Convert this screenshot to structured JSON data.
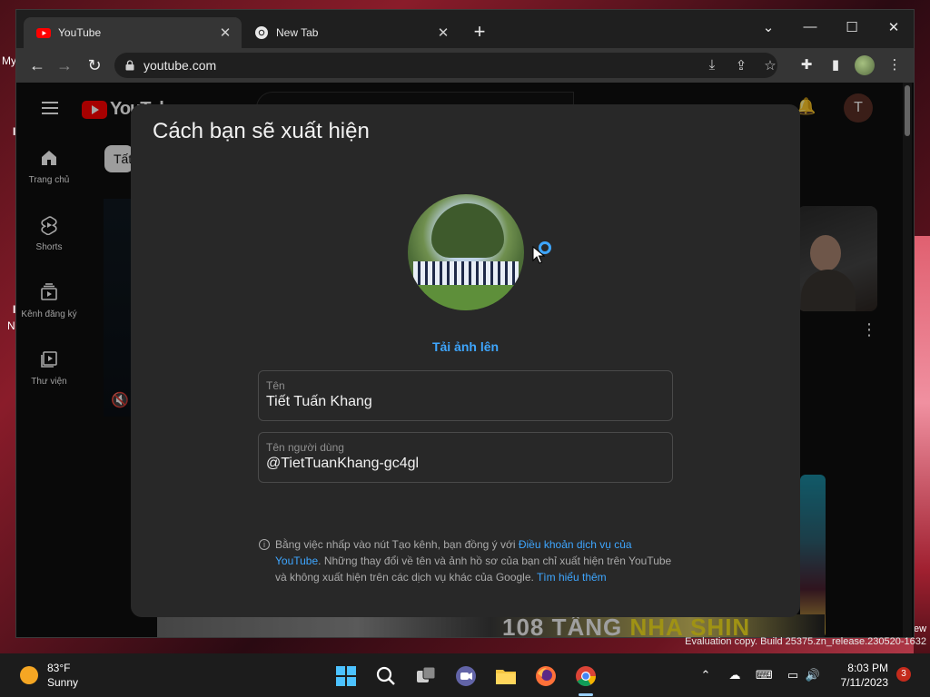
{
  "desktop": {
    "left_fragments": [
      "My",
      "I",
      "I",
      "N"
    ],
    "right_fragment": "ew",
    "evaluation_line": "Evaluation copy. Build 25375.zn_release.230520-1632"
  },
  "browser": {
    "tabs": [
      {
        "title": "YouTube",
        "active": true
      },
      {
        "title": "New Tab",
        "active": false
      }
    ],
    "new_tab_symbol": "+",
    "address": "youtube.com",
    "window_controls": [
      "⌄",
      "—",
      "☐",
      "✕"
    ]
  },
  "youtube": {
    "logo_text": "YouTube",
    "chip_label": "Tất",
    "user_initial": "T",
    "sidebar": [
      {
        "icon": "home-icon",
        "label": "Trang chủ"
      },
      {
        "icon": "shorts-icon",
        "label": "Shorts"
      },
      {
        "icon": "subscriptions-icon",
        "label": "Kênh đăng ký"
      },
      {
        "icon": "library-icon",
        "label": "Thư viện"
      }
    ],
    "bottom_title_a": "108 TẦNG ",
    "bottom_title_b": "NHA SHIN"
  },
  "dialog": {
    "title": "Cách bạn sẽ xuất hiện",
    "upload_link": "Tải ảnh lên",
    "name_field": {
      "label": "Tên",
      "value": "Tiết Tuấn Khang"
    },
    "handle_field": {
      "label": "Tên người dùng",
      "value": "@TietTuanKhang-gc4gl"
    },
    "notice": {
      "part1": "Bằng việc nhấp vào nút Tạo kênh, bạn đồng ý với ",
      "terms_link": "Điều khoản dịch vụ của YouTube",
      "part2": ". Những thay đổi về tên và ảnh hồ sơ của bạn chỉ xuất hiện trên YouTube và không xuất hiện trên các dịch vụ khác của Google. ",
      "learn_more": "Tìm hiểu thêm"
    }
  },
  "taskbar": {
    "temperature": "83°F",
    "condition": "Sunny",
    "time": "8:03 PM",
    "date": "7/11/2023",
    "notification_count": "3"
  },
  "colors": {
    "accent_blue": "#3ea6ff",
    "youtube_red": "#ff0000",
    "dialog_bg": "#282828"
  }
}
